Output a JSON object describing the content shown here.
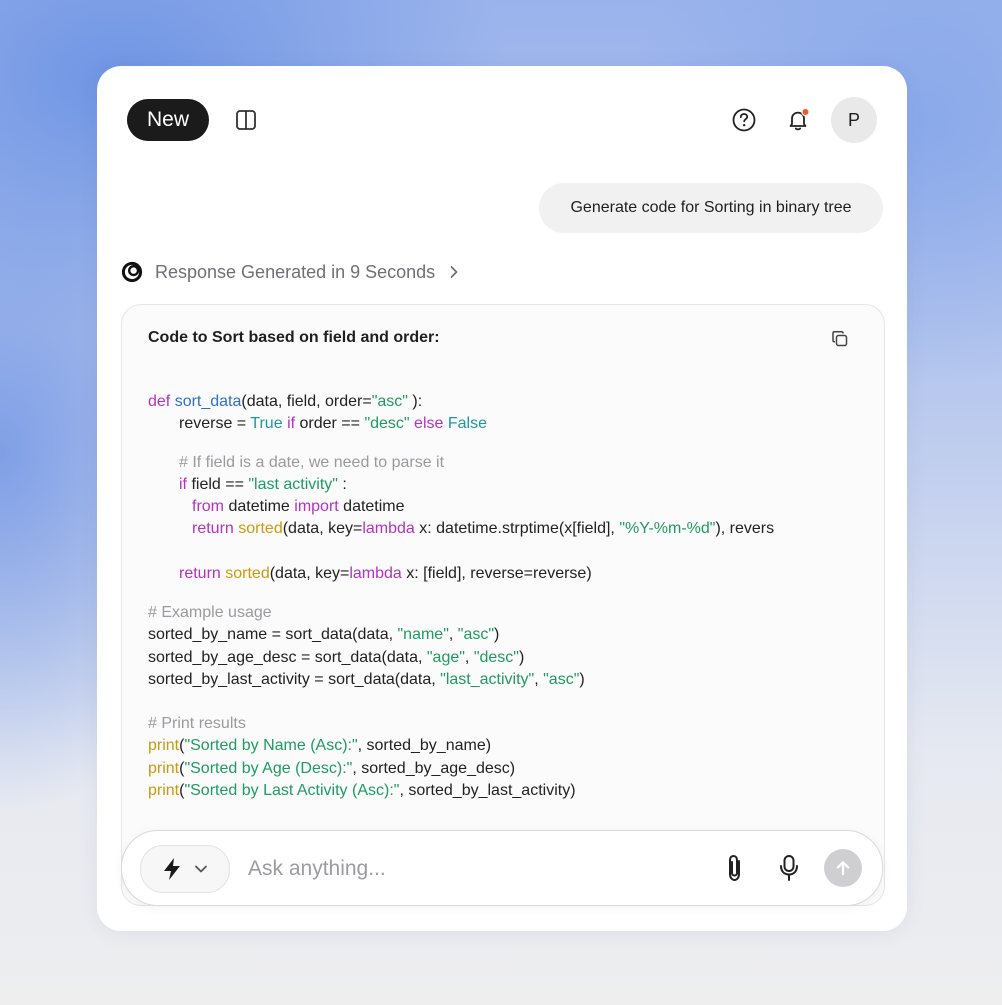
{
  "header": {
    "new_label": "New",
    "avatar_initial": "P",
    "notification_dot_color": "#f2552c"
  },
  "conversation": {
    "user_message": "Generate code for Sorting in binary tree",
    "response_status": "Response Generated in 9 Seconds"
  },
  "code_block": {
    "title": "Code to Sort based on field and order:",
    "lines": [
      {
        "indent": 0,
        "tokens": [
          {
            "t": "kw",
            "v": "def "
          },
          {
            "t": "fn",
            "v": "sort_data"
          },
          {
            "t": "",
            "v": "(data, field, order="
          },
          {
            "t": "str",
            "v": "\"asc\""
          },
          {
            "t": "",
            "v": " ):"
          }
        ]
      },
      {
        "indent": 1,
        "tokens": [
          {
            "t": "",
            "v": "reverse = "
          },
          {
            "t": "bi",
            "v": "True"
          },
          {
            "t": "",
            "v": " "
          },
          {
            "t": "kw",
            "v": "if"
          },
          {
            "t": "",
            "v": " order == "
          },
          {
            "t": "str",
            "v": "\"desc\""
          },
          {
            "t": "",
            "v": " "
          },
          {
            "t": "kw",
            "v": "else"
          },
          {
            "t": "",
            "v": " "
          },
          {
            "t": "bi",
            "v": "False"
          }
        ]
      },
      {
        "indent": 1,
        "tokens": [
          {
            "t": "cm",
            "v": "# If field is a date, we need to parse it"
          }
        ]
      },
      {
        "indent": 1,
        "tokens": [
          {
            "t": "kw",
            "v": "if"
          },
          {
            "t": "",
            "v": " field == "
          },
          {
            "t": "str",
            "v": "\"last activity\""
          },
          {
            "t": "",
            "v": " :"
          }
        ]
      },
      {
        "indent": 2,
        "tokens": [
          {
            "t": "kw",
            "v": "from"
          },
          {
            "t": "",
            "v": " datetime "
          },
          {
            "t": "kw",
            "v": "import"
          },
          {
            "t": "",
            "v": " datetime"
          }
        ]
      },
      {
        "indent": 2,
        "tokens": [
          {
            "t": "kw",
            "v": "return"
          },
          {
            "t": "",
            "v": " "
          },
          {
            "t": "yel",
            "v": "sorted"
          },
          {
            "t": "",
            "v": "(data, key="
          },
          {
            "t": "kw",
            "v": "lambda"
          },
          {
            "t": "",
            "v": " x: datetime.strptime(x[field], "
          },
          {
            "t": "str",
            "v": "\"%Y-%m-%d\""
          },
          {
            "t": "",
            "v": "), revers"
          }
        ]
      },
      {
        "indent": 1,
        "tokens": [
          {
            "t": "kw",
            "v": "return"
          },
          {
            "t": "",
            "v": " "
          },
          {
            "t": "yel",
            "v": "sorted"
          },
          {
            "t": "",
            "v": "(data, key="
          },
          {
            "t": "kw",
            "v": "lambda"
          },
          {
            "t": "",
            "v": " x: [field], reverse=reverse)"
          }
        ]
      },
      {
        "indent": 0,
        "tokens": [
          {
            "t": "cm",
            "v": "# Example usage"
          }
        ]
      },
      {
        "indent": 0,
        "tokens": [
          {
            "t": "",
            "v": "sorted_by_name = sort_data(data, "
          },
          {
            "t": "str",
            "v": "\"name\""
          },
          {
            "t": "",
            "v": ", "
          },
          {
            "t": "str",
            "v": "\"asc\""
          },
          {
            "t": "",
            "v": ")"
          }
        ]
      },
      {
        "indent": 0,
        "tokens": [
          {
            "t": "",
            "v": "sorted_by_age_desc = sort_data(data, "
          },
          {
            "t": "str",
            "v": "\"age\""
          },
          {
            "t": "",
            "v": ", "
          },
          {
            "t": "str",
            "v": "\"desc\""
          },
          {
            "t": "",
            "v": ")"
          }
        ]
      },
      {
        "indent": 0,
        "tokens": [
          {
            "t": "",
            "v": "sorted_by_last_activity = sort_data(data, "
          },
          {
            "t": "str",
            "v": "\"last_activity\""
          },
          {
            "t": "",
            "v": ", "
          },
          {
            "t": "str",
            "v": "\"asc\""
          },
          {
            "t": "",
            "v": ")"
          }
        ]
      },
      {
        "indent": 0,
        "tokens": [
          {
            "t": "cm",
            "v": "# Print results"
          }
        ]
      },
      {
        "indent": 0,
        "tokens": [
          {
            "t": "yel",
            "v": "print"
          },
          {
            "t": "",
            "v": "("
          },
          {
            "t": "str",
            "v": "\"Sorted by Name (Asc):\""
          },
          {
            "t": "",
            "v": ", sorted_by_name)"
          }
        ]
      },
      {
        "indent": 0,
        "tokens": [
          {
            "t": "yel",
            "v": "print"
          },
          {
            "t": "",
            "v": "("
          },
          {
            "t": "str",
            "v": "\"Sorted by Age (Desc):\""
          },
          {
            "t": "",
            "v": ", sorted_by_age_desc)"
          }
        ]
      },
      {
        "indent": 0,
        "tokens": [
          {
            "t": "yel",
            "v": "print"
          },
          {
            "t": "",
            "v": "("
          },
          {
            "t": "str",
            "v": "\"Sorted by Last Activity (Asc):\""
          },
          {
            "t": "",
            "v": ", sorted_by_last_activity)"
          }
        ]
      }
    ]
  },
  "composer": {
    "placeholder": "Ask anything...",
    "mode_icon": "bolt-icon"
  },
  "icons": {
    "sidebar": "sidebar-toggle-icon",
    "help": "help-circle-icon",
    "bell": "bell-icon",
    "status": "spinner-logo-icon",
    "copy": "copy-icon",
    "attach": "paperclip-icon",
    "mic": "microphone-icon",
    "send": "arrow-up-icon"
  }
}
